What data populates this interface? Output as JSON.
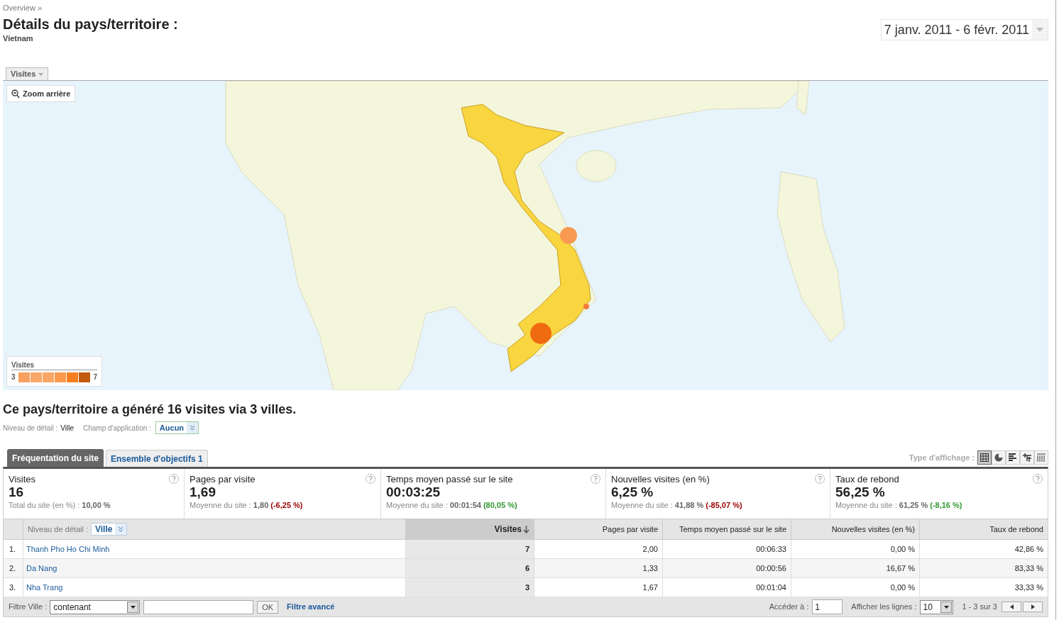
{
  "breadcrumb": "Overview »",
  "title": "Détails du pays/territoire :",
  "subtitle": "Vietnam",
  "date_range": "7 janv. 2011 - 6 févr. 2011",
  "map": {
    "metric_tab": "Visites",
    "zoom_button": "Zoom arrière",
    "legend": {
      "title": "Visites",
      "min": "3",
      "max": "7"
    }
  },
  "summary": "Ce pays/territoire a généré 16 visites via 3 villes.",
  "detail_level": {
    "label": "Niveau de détail :",
    "value": "Ville"
  },
  "scope": {
    "label": "Champ d'application :",
    "value": "Aucun"
  },
  "tabs": [
    {
      "label": "Fréquentation du site",
      "selected": true
    },
    {
      "label": "Ensemble d'objectifs 1",
      "selected": false
    }
  ],
  "view_type": {
    "label": "Type d'affichage :",
    "buttons": [
      {
        "kind": "table",
        "selected": true
      },
      {
        "kind": "pie",
        "selected": false
      },
      {
        "kind": "bars",
        "selected": false
      },
      {
        "kind": "compare",
        "selected": false
      },
      {
        "kind": "pivot",
        "selected": false
      }
    ]
  },
  "metrics": [
    {
      "label": "Visites",
      "value": "16",
      "sub_label": "Total du site (en %) :",
      "sub_value": "10,00 %"
    },
    {
      "label": "Pages par visite",
      "value": "1,69",
      "sub_label": "Moyenne du site :",
      "sub_value": "1,80",
      "change": "(-6,25 %)",
      "color": "#990000"
    },
    {
      "label": "Temps moyen passé sur le site",
      "value": "00:03:25",
      "sub_label": "Moyenne du site :",
      "sub_value": "00:01:54",
      "change": "(80,05 %)",
      "color": "#339933"
    },
    {
      "label": "Nouvelles visites (en %)",
      "value": "6,25 %",
      "sub_label": "Moyenne du site :",
      "sub_value": "41,88 %",
      "change": "(-85,07 %)",
      "color": "#990000"
    },
    {
      "label": "Taux de rebond",
      "value": "56,25 %",
      "sub_label": "Moyenne du site :",
      "sub_value": "61,25 %",
      "change": "(-8,16 %)",
      "color": "#339933"
    }
  ],
  "table": {
    "detail_label": "Niveau de détail :",
    "detail_value": "Ville",
    "columns": [
      {
        "label": "Visites",
        "sorted": true
      },
      {
        "label": "Pages par visite",
        "sorted": false
      },
      {
        "label": "Temps moyen passé sur le site",
        "sorted": false
      },
      {
        "label": "Nouvelles visites (en %)",
        "sorted": false
      },
      {
        "label": "Taux de rebond",
        "sorted": false
      }
    ],
    "rows": [
      {
        "index": "1.",
        "city": "Thanh Pho Ho Chi Minh",
        "cells": [
          "7",
          "2,00",
          "00:06:33",
          "0,00 %",
          "42,86 %"
        ]
      },
      {
        "index": "2.",
        "city": "Da Nang",
        "cells": [
          "6",
          "1,33",
          "00:00:56",
          "16,67 %",
          "83,33 %"
        ]
      },
      {
        "index": "3.",
        "city": "Nha Trang",
        "cells": [
          "3",
          "1,67",
          "00:01:04",
          "0,00 %",
          "33,33 %"
        ]
      }
    ]
  },
  "filter": {
    "label": "Filtre Ville :",
    "operator": "contenant",
    "ok": "OK",
    "advanced": "Filtre avancé",
    "goto_label": "Accéder à :",
    "goto_value": "1",
    "rows_label": "Afficher les lignes :",
    "rows_value": "10",
    "range": "1 - 3 sur 3"
  }
}
